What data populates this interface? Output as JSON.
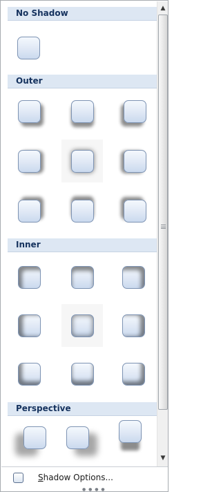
{
  "sections": [
    {
      "title": "No Shadow"
    },
    {
      "title": "Outer"
    },
    {
      "title": "Inner"
    },
    {
      "title": "Perspective"
    }
  ],
  "footer": {
    "options_label": "Shadow Options...",
    "mnemonic": "S",
    "label_rest": "hadow Options..."
  },
  "icons": {
    "scroll_up": "scroll-up-arrow-icon",
    "scroll_down": "scroll-down-arrow-icon",
    "thumb_grip": "scroll-grip-icon",
    "resize_grip": "resize-grip-icon"
  },
  "scrollbar": {
    "position_fraction": 0.0,
    "visible_fraction": 0.85
  },
  "colors": {
    "header_bg": "#dde7f3",
    "header_text": "#15325e",
    "tile_border": "#7d93b3"
  }
}
